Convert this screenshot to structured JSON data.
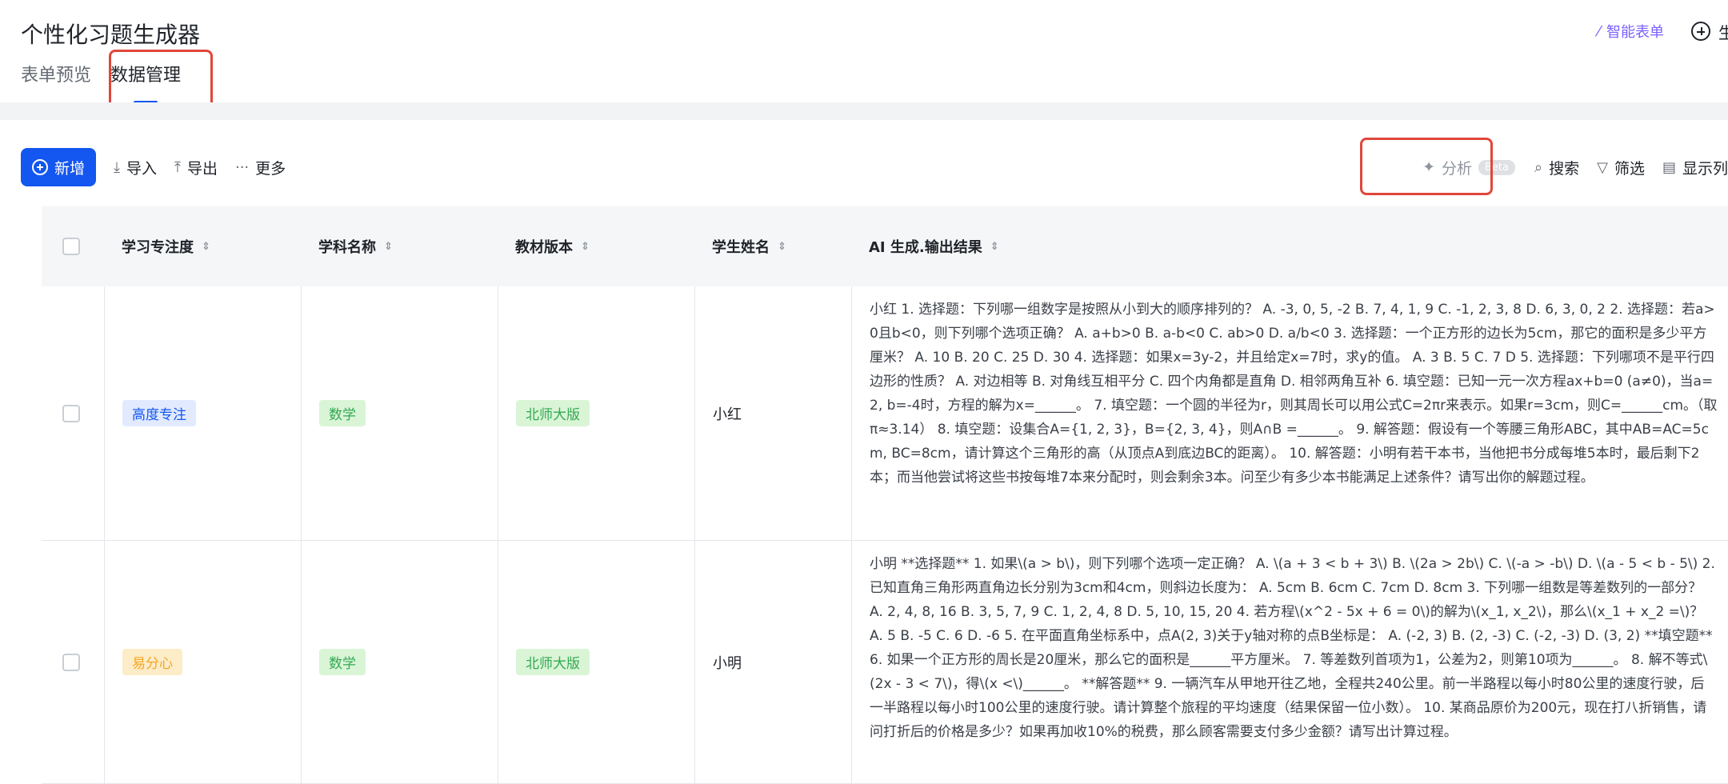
{
  "app": {
    "title": "个性化习题生成器",
    "smart_form_label": "智能表单",
    "create_label": "生"
  },
  "tabs": [
    {
      "label": "表单预览",
      "active": false
    },
    {
      "label": "数据管理",
      "active": true
    }
  ],
  "toolbar": {
    "new_label": "新增",
    "import_label": "导入",
    "export_label": "导出",
    "more_label": "更多",
    "analyze_label": "分析",
    "beta_label": "Beta",
    "search_label": "搜索",
    "filter_label": "筛选",
    "show_columns_label": "显示列"
  },
  "table": {
    "columns": [
      "学习专注度",
      "学科名称",
      "教材版本",
      "学生姓名",
      "AI 生成.输出结果"
    ],
    "rows": [
      {
        "focus": "高度专注",
        "subject": "数学",
        "edition": "北师大版",
        "student": "小红",
        "ai_output": "小红 1. 选择题：下列哪一组数字是按照从小到大的顺序排列的？ A. -3, 0, 5, -2 B. 7, 4, 1, 9 C. -1, 2, 3, 8 D. 6, 3, 0, 2 2. 选择题：若a>0且b<0，则下列哪个选项正确？ A. a+b>0 B. a-b<0 C. ab>0 D. a/b<0 3. 选择题：一个正方形的边长为5cm，那它的面积是多少平方厘米？ A. 10 B. 20 C. 25 D. 30 4. 选择题：如果x=3y-2，并且给定x=7时，求y的值。 A. 3 B. 5 C. 7 D 5. 选择题：下列哪项不是平行四边形的性质？ A. 对边相等 B. 对角线互相平分 C. 四个内角都是直角 D. 相邻两角互补 6. 填空题：已知一元一次方程ax+b=0 (a≠0)，当a=2, b=-4时，方程的解为x=______。 7. 填空题：一个圆的半径为r，则其周长可以用公式C=2πr来表示。如果r=3cm，则C=______cm。（取π≈3.14） 8. 填空题：设集合A={1, 2, 3}，B={2, 3, 4}，则A∩B =______。 9. 解答题：假设有一个等腰三角形ABC，其中AB=AC=5cm, BC=8cm，请计算这个三角形的高（从顶点A到底边BC的距离）。 10. 解答题：小明有若干本书，当他把书分成每堆5本时，最后剩下2本；而当他尝试将这些书按每堆7本来分配时，则会剩余3本。问至少有多少本书能满足上述条件？请写出你的解题过程。"
      },
      {
        "focus": "易分心",
        "subject": "数学",
        "edition": "北师大版",
        "student": "小明",
        "ai_output": "小明 **选择题** 1. 如果\\(a > b\\)，则下列哪个选项一定正确？ A. \\(a + 3 < b + 3\\) B. \\(2a > 2b\\) C. \\(-a > -b\\) D. \\(a - 5 < b - 5\\) 2. 已知直角三角形两直角边长分别为3cm和4cm，则斜边长度为： A. 5cm B. 6cm C. 7cm D. 8cm 3. 下列哪一组数是等差数列的一部分？ A. 2, 4, 8, 16 B. 3, 5, 7, 9 C. 1, 2, 4, 8 D. 5, 10, 15, 20 4. 若方程\\(x^2 - 5x + 6 = 0\\)的解为\\(x_1, x_2\\)，那么\\(x_1 + x_2 =\\)？ A. 5 B. -5 C. 6 D. -6 5. 在平面直角坐标系中，点A(2, 3)关于y轴对称的点B坐标是： A. (-2, 3) B. (2, -3) C. (-2, -3) D. (3, 2) **填空题** 6. 如果一个正方形的周长是20厘米，那么它的面积是______平方厘米。 7. 等差数列首项为1，公差为2，则第10项为______。 8. 解不等式\\(2x - 3 < 7\\)，得\\(x <\\)______。 **解答题** 9. 一辆汽车从甲地开往乙地，全程共240公里。前一半路程以每小时80公里的速度行驶，后一半路程以每小时100公里的速度行驶。请计算整个旅程的平均速度（结果保留一位小数）。 10. 某商品原价为200元，现在打八折销售，请问打折后的价格是多少？如果再加收10%的税费，那么顾客需要支付多少金额？请写出计算过程。"
      }
    ]
  },
  "colors": {
    "primary": "#1456f0",
    "highlight_box": "#e0473a",
    "smart_form": "#7b61ff"
  }
}
